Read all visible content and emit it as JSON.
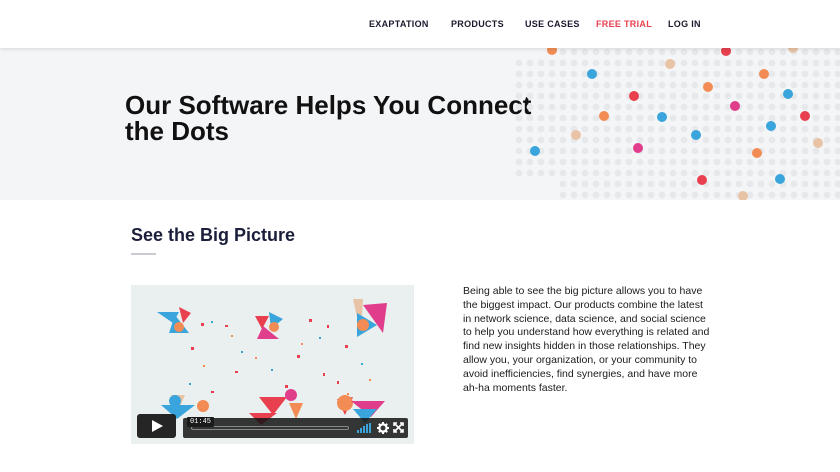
{
  "nav": {
    "items": [
      {
        "label": "EXAPTATION"
      },
      {
        "label": "PRODUCTS"
      },
      {
        "label": "USE CASES"
      },
      {
        "label": "FREE TRIAL"
      },
      {
        "label": "LOG IN"
      }
    ],
    "accent_color": "#e8404f"
  },
  "hero": {
    "title_line1": "Our Software Helps You Connect",
    "title_line2": "the Dots",
    "dot_colors": [
      "#e8404f",
      "#f28c54",
      "#3aa5dc",
      "#e03e8c",
      "#e9c3a5"
    ]
  },
  "section": {
    "title": "See the Big Picture",
    "body": "Being able to see the big picture allows you to have the biggest impact. Our products combine the latest in network science, data science, and social science to help you understand how everything is related and find new insights hidden in those relationships. They allow you, your organization, or your community to avoid inefficiencies, find synergies, and have more ah-ha moments faster."
  },
  "video": {
    "time_tooltip": "01:45",
    "icons": [
      "play-icon",
      "volume-icon",
      "gear-icon",
      "fullscreen-icon"
    ]
  }
}
